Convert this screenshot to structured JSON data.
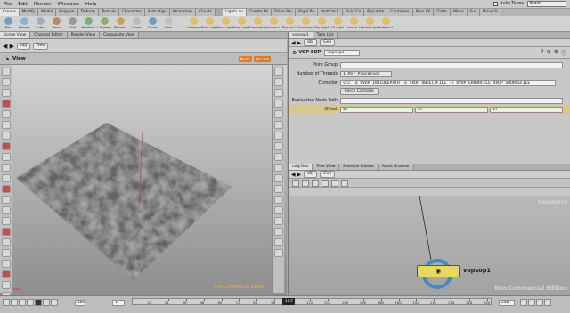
{
  "menubar": {
    "items": [
      "File",
      "Edit",
      "Render",
      "Windows",
      "Help"
    ],
    "auto_takes": "Auto Takes",
    "desktop": "Main"
  },
  "shelf": {
    "tabs_left": [
      "Create",
      "Modify",
      "Model",
      "Polygon",
      "Deform",
      "Texture",
      "Character",
      "Auto Rigs",
      "Animation",
      "Clouds"
    ],
    "tabs_right": [
      "Lights an",
      "Create Pa",
      "Drive Par",
      "Rigid Bo",
      "Particle F",
      "Fluid Co",
      "Populate",
      "Container",
      "Pyro FX",
      "Cloth",
      "Wires",
      "Fur",
      "Drive Si"
    ],
    "tools_left": [
      "Box",
      "Sphere",
      "Tube",
      "Torus",
      "Grid",
      "Metaball",
      "L-System",
      "Platonic",
      "Curve",
      "Circle",
      "Font"
    ],
    "tools_right": [
      "Camera",
      "Point Light",
      "Spot Light",
      "Area Light",
      "Geometry",
      "Volume Li",
      "Distant Li",
      "Environm",
      "Sky Light",
      "GI Light",
      "Caustic Li",
      "Portal Light",
      "Ambient L"
    ]
  },
  "left_pane": {
    "tabs": [
      "Scene View",
      "Channel Editor",
      "Render View",
      "Composite View"
    ],
    "path": [
      "obj",
      "Geo"
    ],
    "view_label": "View",
    "camera_tags": [
      "Persp",
      "No cam"
    ],
    "watermark": "Non-Commercial Edition"
  },
  "param_pane": {
    "tabs": [
      "vopsop1",
      "Take List"
    ],
    "path": [
      "obj",
      "Geo"
    ],
    "node_type": "VOP SOP",
    "node_name": "vopsop1",
    "params": {
      "point_group_label": "Point Group",
      "point_group_value": "",
      "threads_label": "Number of Threads",
      "threads_value": "1 Per Processor",
      "compiler_label": "Compiler",
      "compiler_value": "vcc -q $VOP_INCLUDEPATH -o $VOP_OBJECTFILE -e $VOP_ERRORFILE $VOP_SOURCEFILE",
      "force_compile": "Force Compile",
      "eval_path_label": "Evaluation Node Path",
      "eval_path_value": "",
      "offset_label": "Offset",
      "offset_values": [
        "$T",
        "$T",
        "$T"
      ]
    }
  },
  "net_pane": {
    "tabs": [
      "/obj/Geo",
      "Tree View",
      "Material Palette",
      "Asset Browser"
    ],
    "path": [
      "obj",
      "Geo"
    ],
    "context_label": "Geometry",
    "node_name": "vopsop1",
    "watermark": "Non-Commercial Edition"
  },
  "timeline": {
    "current_frame": "103",
    "start_field": "103",
    "step_field": "1",
    "end_field": "240",
    "ticks": [
      "12",
      "24",
      "36",
      "48",
      "60",
      "72",
      "84",
      "96",
      "108",
      "120",
      "132",
      "144",
      "156",
      "168",
      "180",
      "192",
      "204",
      "216",
      "228",
      "240"
    ]
  },
  "colors": {
    "accent": "#d77b2d",
    "node_ring": "#2f7fc0",
    "node_body": "#e8d862"
  }
}
